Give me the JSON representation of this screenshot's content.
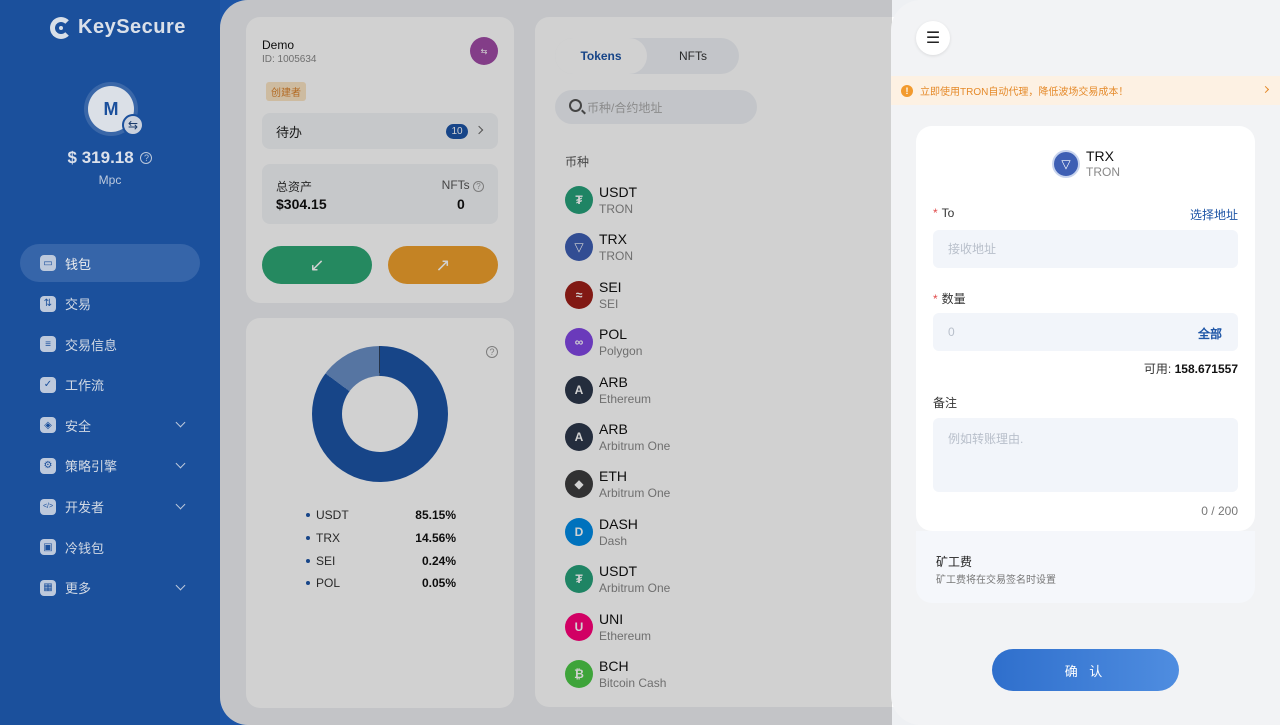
{
  "brand": {
    "name": "KeySecure"
  },
  "profile": {
    "initial": "M",
    "balance": "$ 319.18",
    "type": "Mpc"
  },
  "sidebar": {
    "items": [
      {
        "label": "钱包",
        "icon": "wallet-icon",
        "active": true
      },
      {
        "label": "交易",
        "icon": "exchange-icon"
      },
      {
        "label": "交易信息",
        "icon": "transaction-info-icon"
      },
      {
        "label": "工作流",
        "icon": "workflow-icon"
      },
      {
        "label": "安全",
        "icon": "shield-icon",
        "expandable": true
      },
      {
        "label": "策略引擎",
        "icon": "policy-icon",
        "expandable": true
      },
      {
        "label": "开发者",
        "icon": "developer-icon",
        "expandable": true
      },
      {
        "label": "冷钱包",
        "icon": "cold-wallet-icon"
      },
      {
        "label": "更多",
        "icon": "more-icon",
        "expandable": true
      }
    ]
  },
  "account": {
    "name": "Demo",
    "id": "ID: 1005634",
    "role": "创建者",
    "todo_label": "待办",
    "todo_count": "10",
    "total_assets_label": "总资产",
    "total_assets_value": "$304.15",
    "nfts_label": "NFTs",
    "nfts_value": "0"
  },
  "allocation": {
    "items": [
      {
        "name": "USDT",
        "pct": "85.15%"
      },
      {
        "name": "TRX",
        "pct": "14.56%"
      },
      {
        "name": "SEI",
        "pct": "0.24%"
      },
      {
        "name": "POL",
        "pct": "0.05%"
      }
    ]
  },
  "tokens_panel": {
    "tabs": [
      "Tokens",
      "NFTs"
    ],
    "search_placeholder": "币种/合约地址",
    "column_header": "币种",
    "items": [
      {
        "symbol": "USDT",
        "network": "TRON",
        "color": "#26a17b"
      },
      {
        "symbol": "TRX",
        "network": "TRON",
        "color": "#3e5fb4"
      },
      {
        "symbol": "SEI",
        "network": "SEI",
        "color": "#9e1f19"
      },
      {
        "symbol": "POL",
        "network": "Polygon",
        "color": "#8247e5"
      },
      {
        "symbol": "ARB",
        "network": "Ethereum",
        "color": "#2d374b"
      },
      {
        "symbol": "ARB",
        "network": "Arbitrum One",
        "color": "#2d374b"
      },
      {
        "symbol": "ETH",
        "network": "Arbitrum One",
        "color": "#3c3c3d"
      },
      {
        "symbol": "DASH",
        "network": "Dash",
        "color": "#008ce7"
      },
      {
        "symbol": "USDT",
        "network": "Arbitrum One",
        "color": "#26a17b"
      },
      {
        "symbol": "UNI",
        "network": "Ethereum",
        "color": "#ff007a"
      },
      {
        "symbol": "BCH",
        "network": "Bitcoin Cash",
        "color": "#4cc947"
      }
    ]
  },
  "drawer": {
    "notice": "立即使用TRON自动代理，降低波场交易成本！",
    "asset": {
      "symbol": "TRX",
      "network": "TRON"
    },
    "to_label": "To",
    "select_address": "选择地址",
    "to_placeholder": "接收地址",
    "amount_label": "数量",
    "amount_placeholder": "0",
    "all_label": "全部",
    "available_label": "可用:",
    "available_value": "158.671557",
    "memo_label": "备注",
    "memo_placeholder": "例如转账理由.",
    "memo_counter": "0 / 200",
    "fee_title": "矿工费",
    "fee_desc": "矿工费将在交易签名时设置",
    "confirm": "确 认"
  }
}
